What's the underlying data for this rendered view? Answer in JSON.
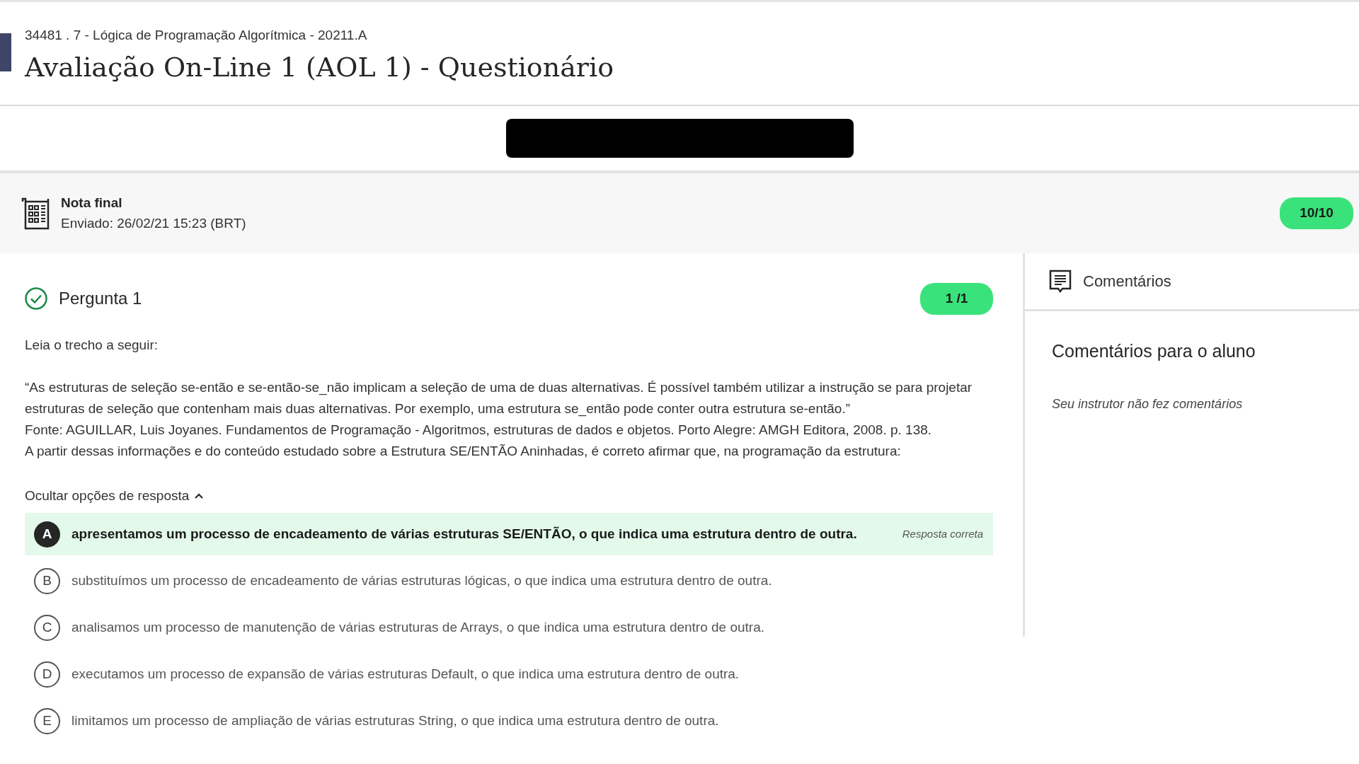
{
  "course": "34481 . 7 - Lógica de Programação Algorítmica - 20211.A",
  "title": "Avaliação On-Line 1 (AOL 1) - Questionário",
  "grade": {
    "label": "Nota final",
    "submitted": "Enviado: 26/02/21 15:23 (BRT)",
    "score": "10/10"
  },
  "question": {
    "title": "Pergunta 1",
    "correct": true,
    "score": "1 /1",
    "intro": "Leia o trecho a seguir:",
    "paragraphs": [
      "“As estruturas de seleção se-então e se-então-se_não implicam a seleção de uma de duas alternativas. É possível também utilizar a instrução se para projetar estruturas de seleção que contenham mais duas alternativas. Por exemplo, uma estrutura se_então pode conter outra estrutura se-então.”",
      "Fonte: AGUILLAR, Luis Joyanes. Fundamentos de Programação - Algoritmos, estruturas de dados e objetos. Porto Alegre: AMGH Editora, 2008. p. 138.",
      "A partir dessas informações e do conteúdo estudado sobre a Estrutura SE/ENTÃO Aninhadas, é correto afirmar que, na programação da estrutura:"
    ],
    "toggle": {
      "label": "Ocultar opções de resposta",
      "expanded": true
    },
    "options": [
      {
        "letter": "A",
        "text": "apresentamos um processo de encadeamento de várias estruturas SE/ENTÃO, o que indica uma estrutura dentro de outra.",
        "selected": true,
        "note": "Resposta correta"
      },
      {
        "letter": "B",
        "text": "substituímos um processo de encadeamento de várias estruturas lógicas, o que indica uma estrutura dentro de outra.",
        "selected": false
      },
      {
        "letter": "C",
        "text": "analisamos um processo de manutenção de várias estruturas de Arrays, o que indica uma estrutura dentro de outra.",
        "selected": false
      },
      {
        "letter": "D",
        "text": "executamos um processo de expansão de várias estruturas Default, o que indica uma estrutura dentro de outra.",
        "selected": false
      },
      {
        "letter": "E",
        "text": "limitamos um processo de ampliação de várias estruturas String, o que indica uma estrutura dentro de outra.",
        "selected": false
      }
    ]
  },
  "comments": {
    "tab": "Comentários",
    "heading": "Comentários para o aluno",
    "text": "Seu instrutor não fez comentários"
  }
}
